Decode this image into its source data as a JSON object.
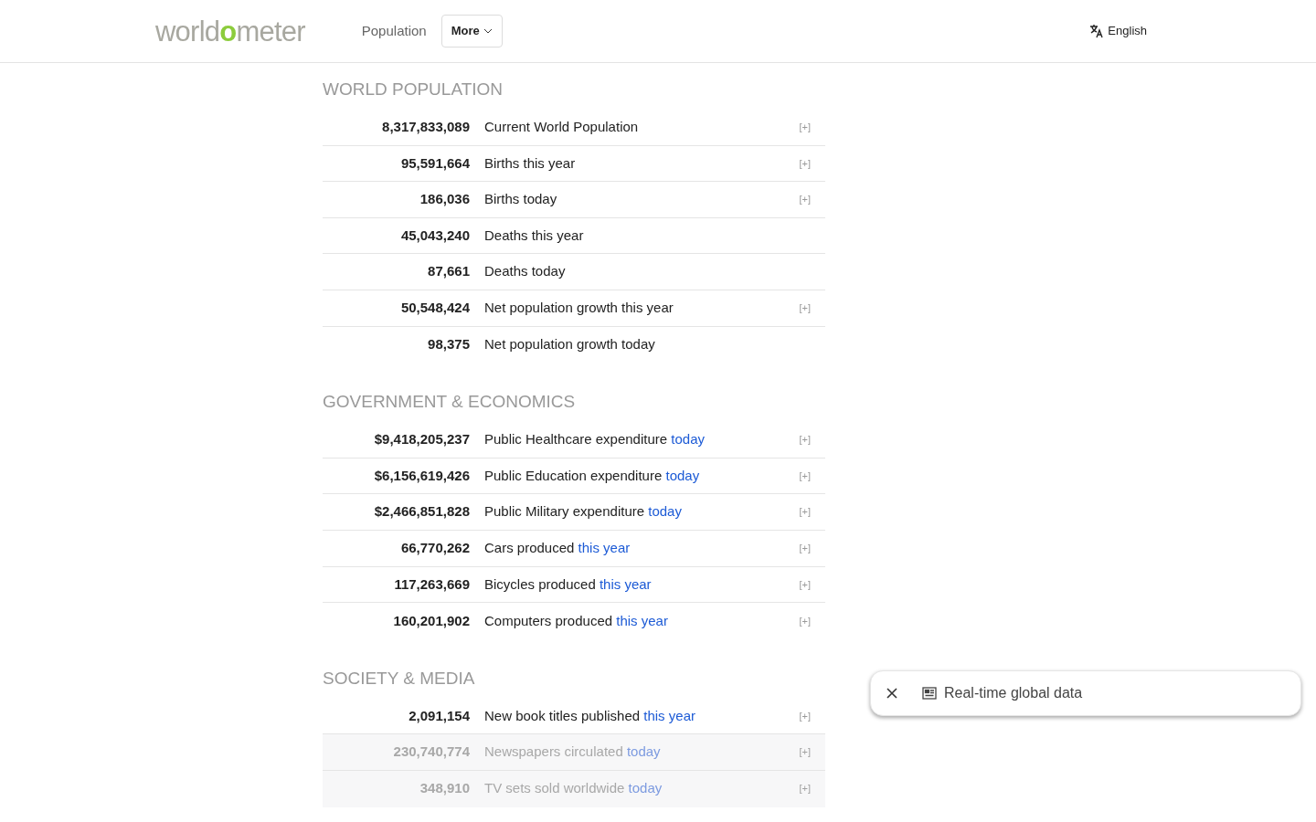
{
  "header": {
    "logo": {
      "before": "world",
      "highlight": "o",
      "after": "meter"
    },
    "nav": [
      {
        "label": "Population",
        "kind": "link"
      },
      {
        "label": "More",
        "kind": "dropdown"
      }
    ],
    "language": "English"
  },
  "sections": [
    {
      "title": "WORLD POPULATION",
      "rows": [
        {
          "value": "8,317,833,089",
          "label": "Current World Population",
          "expand": "[+]",
          "dimmed": false
        },
        {
          "value": "95,591,664",
          "label": "Births this year",
          "expand": "[+]",
          "dimmed": false
        },
        {
          "value": "186,036",
          "label": "Births today",
          "expand": "[+]",
          "dimmed": false
        },
        {
          "value": "45,043,240",
          "label": "Deaths this year",
          "dimmed": false
        },
        {
          "value": "87,661",
          "label": "Deaths today",
          "dimmed": false
        },
        {
          "value": "50,548,424",
          "label": "Net population growth this year",
          "expand": "[+]",
          "dimmed": false
        },
        {
          "value": "98,375",
          "label": "Net population growth today",
          "dimmed": false
        }
      ]
    },
    {
      "title": "GOVERNMENT & ECONOMICS",
      "rows": [
        {
          "value": "$9,418,205,237",
          "label": "Public Healthcare expenditure",
          "link": "today",
          "expand": "[+]",
          "dimmed": false
        },
        {
          "value": "$6,156,619,426",
          "label": "Public Education expenditure",
          "link": "today",
          "expand": "[+]",
          "dimmed": false
        },
        {
          "value": "$2,466,851,828",
          "label": "Public Military expenditure",
          "link": "today",
          "expand": "[+]",
          "dimmed": false
        },
        {
          "value": "66,770,262",
          "label": "Cars produced",
          "link": "this year",
          "expand": "[+]",
          "dimmed": false
        },
        {
          "value": "117,263,669",
          "label": "Bicycles produced",
          "link": "this year",
          "expand": "[+]",
          "dimmed": false
        },
        {
          "value": "160,201,902",
          "label": "Computers produced",
          "link": "this year",
          "expand": "[+]",
          "dimmed": false
        }
      ]
    },
    {
      "title": "SOCIETY & MEDIA",
      "rows": [
        {
          "value": "2,091,154",
          "label": "New book titles published",
          "link": "this year",
          "expand": "[+]",
          "dimmed": false
        },
        {
          "value": "230,740,774",
          "label": "Newspapers circulated",
          "link": "today",
          "expand": "[+]",
          "dimmed": true
        },
        {
          "value": "348,910",
          "label": "TV sets sold worldwide",
          "link": "today",
          "expand": "[+]",
          "dimmed": true
        }
      ]
    }
  ],
  "toast": {
    "text": "Real-time global data"
  }
}
